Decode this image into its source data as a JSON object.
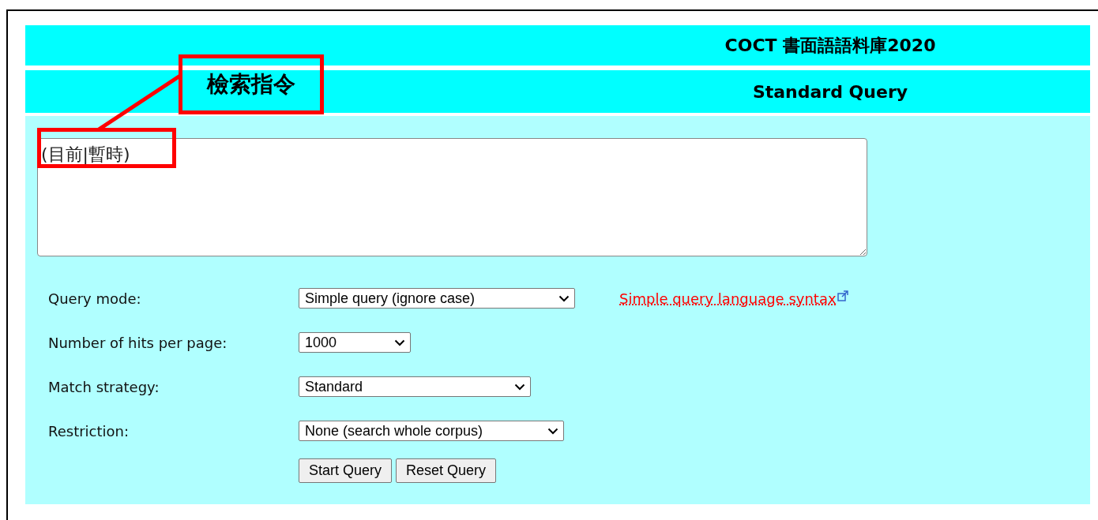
{
  "header": {
    "title": "COCT 書面語語料庫2020",
    "subtitle": "Standard Query"
  },
  "annotation": {
    "label": "檢索指令"
  },
  "query": {
    "value": "(目前|暫時)"
  },
  "form": [
    {
      "label": "Query mode:",
      "value": "Simple query (ignore case)",
      "link": "Simple query language syntax"
    },
    {
      "label": "Number of hits per page:",
      "value": "1000"
    },
    {
      "label": "Match strategy:",
      "value": "Standard"
    },
    {
      "label": "Restriction:",
      "value": "None (search whole corpus)"
    }
  ],
  "buttons": [
    "Start Query",
    "Reset Query"
  ]
}
